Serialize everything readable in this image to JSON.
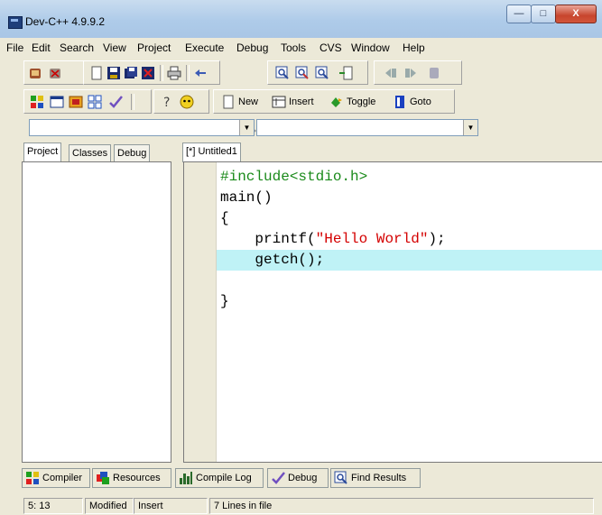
{
  "window": {
    "title": "Dev-C++ 4.9.9.2"
  },
  "menubar": [
    "File",
    "Edit",
    "Search",
    "View",
    "Project",
    "Execute",
    "Debug",
    "Tools",
    "CVS",
    "Window",
    "Help"
  ],
  "toolbar2": {
    "new_label": "New",
    "insert_label": "Insert",
    "toggle_label": "Toggle",
    "goto_label": "Goto"
  },
  "combos": {
    "class_value": "",
    "member_value": ""
  },
  "left_tabs": [
    "Project",
    "Classes",
    "Debug"
  ],
  "editor": {
    "tab_label": "[*] Untitled1",
    "lines": [
      {
        "parts": [
          {
            "t": "#include<stdio.h>",
            "c": "pp"
          }
        ]
      },
      {
        "parts": [
          {
            "t": "main()",
            "c": ""
          }
        ]
      },
      {
        "parts": [
          {
            "t": "{",
            "c": ""
          }
        ]
      },
      {
        "parts": [
          {
            "t": "    printf(",
            "c": ""
          },
          {
            "t": "\"Hello World\"",
            "c": "str"
          },
          {
            "t": ");",
            "c": ""
          }
        ]
      },
      {
        "parts": [
          {
            "t": "    getch();",
            "c": ""
          }
        ],
        "highlight": true
      },
      {
        "parts": [
          {
            "t": "",
            "c": ""
          }
        ]
      },
      {
        "parts": [
          {
            "t": "}",
            "c": ""
          }
        ]
      }
    ]
  },
  "bottom_tabs": [
    "Compiler",
    "Resources",
    "Compile Log",
    "Debug",
    "Find Results"
  ],
  "status": {
    "position": "5: 13",
    "modified": "Modified",
    "mode": "Insert",
    "lines": "7 Lines in file"
  },
  "colors": {
    "title_gradient_top": "#c9dcef",
    "close_button": "#c7452d",
    "highlight_line": "#bff2f6",
    "preprocessor": "#1a8a1a",
    "string": "#d40000"
  }
}
